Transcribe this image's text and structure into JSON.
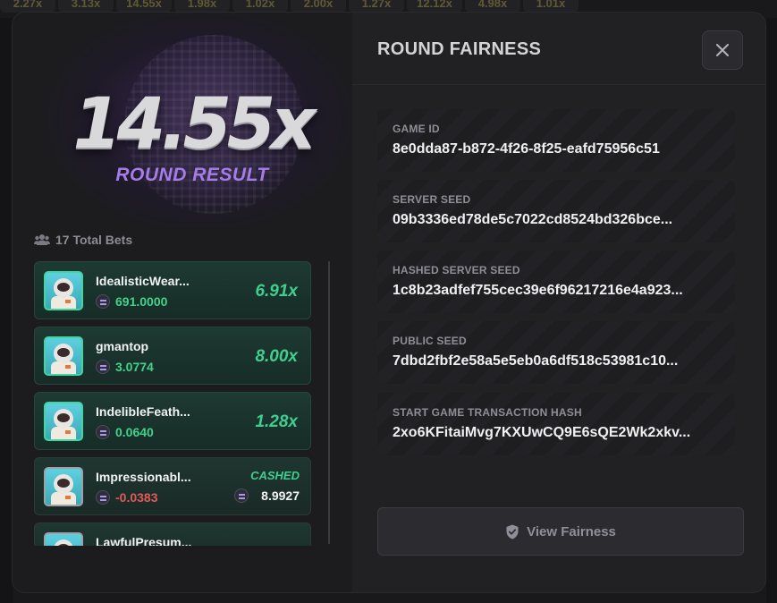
{
  "top_strip": [
    "2.27x",
    "3.13x",
    "14.55x",
    "1.98x",
    "1.02x",
    "2.00x",
    "1.27x",
    "12.12x",
    "4.98x",
    "1.01x"
  ],
  "hero": {
    "multiplier": "14.55x",
    "label": "ROUND RESULT"
  },
  "bets": {
    "count_label": "17 Total Bets",
    "items": [
      {
        "name": "IdealisticWear...",
        "amount": "691.0000",
        "multiplier": "6.91x",
        "status": "win"
      },
      {
        "name": "gmantop",
        "amount": "3.0774",
        "multiplier": "8.00x",
        "status": "win"
      },
      {
        "name": "IndelibleFeath...",
        "amount": "0.0640",
        "multiplier": "1.28x",
        "status": "win"
      },
      {
        "name": "Impressionabl...",
        "amount": "-0.0383",
        "cashed_label": "CASHED",
        "cashed_amount": "8.9927",
        "status": "cashed"
      },
      {
        "name": "LawfulPresum...",
        "amount": "",
        "multiplier": "",
        "status": "win"
      }
    ]
  },
  "fairness": {
    "title": "ROUND FAIRNESS",
    "fields": [
      {
        "label": "GAME ID",
        "value": "8e0dda87-b872-4f26-8f25-eafd75956c51"
      },
      {
        "label": "SERVER SEED",
        "value": "09b3336ed78de5c7022cd8524bd326bce..."
      },
      {
        "label": "HASHED SERVER SEED",
        "value": "1c8b23adfef755cec39e6f96217216e4a923..."
      },
      {
        "label": "PUBLIC SEED",
        "value": "7dbd2fbf2e58a5e5eb0a6df518c53981c10..."
      },
      {
        "label": "START GAME TRANSACTION HASH",
        "value": "2xo6KFitaiMvg7KXUwCQ9E6sQE2Wk2xkv..."
      }
    ],
    "view_button": "View Fairness"
  },
  "icons": {
    "close": "close-icon",
    "users": "users-icon",
    "shield": "shield-check-icon",
    "coin": "solana-coin-icon"
  },
  "colors": {
    "accent_purple": "#a67de8",
    "win_green": "#3fcf8e",
    "loss_red": "#e05a5a"
  }
}
